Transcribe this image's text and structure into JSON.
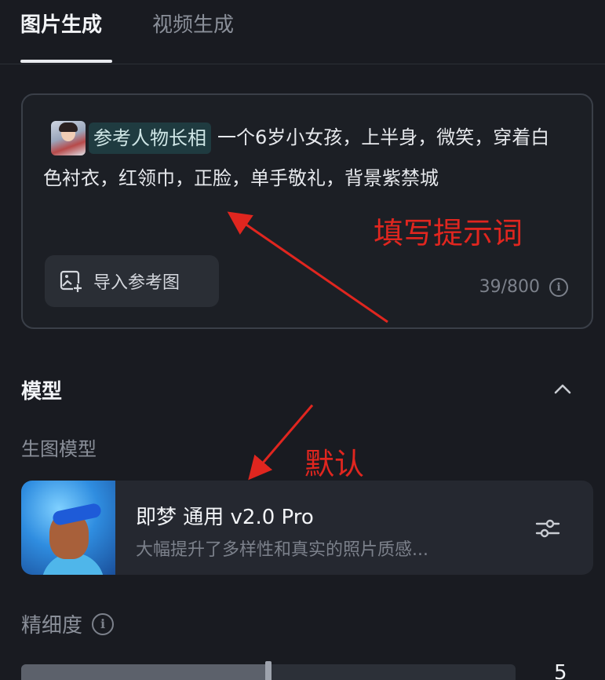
{
  "tabs": [
    {
      "label": "图片生成",
      "active": true
    },
    {
      "label": "视频生成",
      "active": false
    }
  ],
  "prompt": {
    "reference_tag": "参考人物长相",
    "text": "一个6岁小女孩，上半身，微笑，穿着白色衬衣，红领巾，正脸，单手敬礼，背景紫禁城",
    "import_button": "导入参考图",
    "counter": "39/800"
  },
  "annotations": {
    "fill_prompt": "填写提示词",
    "default": "默认"
  },
  "model_section": {
    "title": "模型",
    "sub_label": "生图模型",
    "model_name": "即梦 通用 v2.0 Pro",
    "model_desc": "大幅提升了多样性和真实的照片质感..."
  },
  "fineness": {
    "label": "精细度",
    "value": "5",
    "fill_fraction": 0.5
  },
  "colors": {
    "background": "#191b21",
    "annotation_red": "#e0261f",
    "tag_bg": "#1f3b40"
  },
  "icons": [
    "image-import-icon",
    "info-icon",
    "chevron-up-icon",
    "sliders-icon"
  ]
}
